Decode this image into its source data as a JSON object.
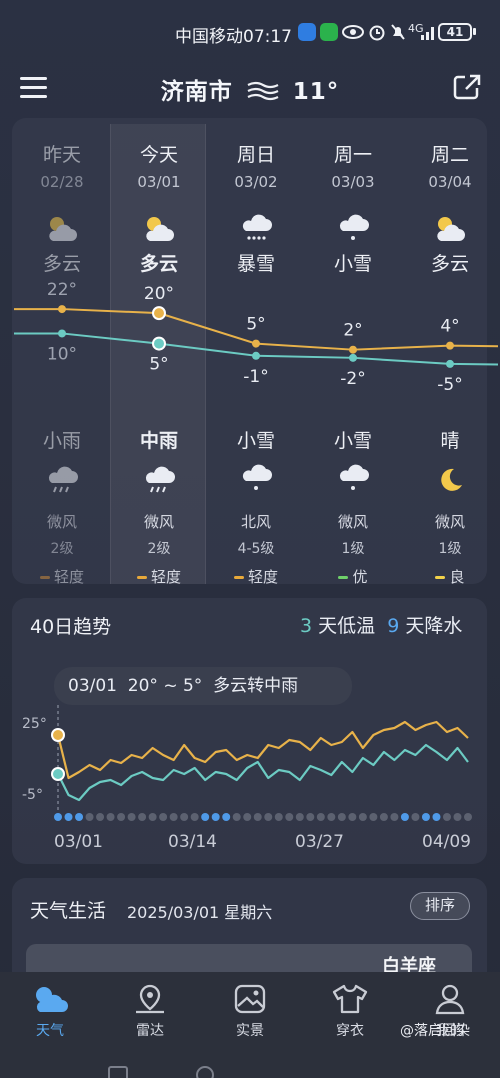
{
  "status_bar": {
    "carrier": "中国移动",
    "time": "07:17",
    "signal": "4G",
    "battery": "41"
  },
  "header": {
    "city": "济南市",
    "temp": "11°",
    "condition_icon": "haze-icon"
  },
  "days": [
    {
      "name": "昨天",
      "date": "02/28",
      "day_condition": "多云",
      "high": "22°",
      "low": "10°",
      "night_condition": "小雨",
      "wind_dir": "微风",
      "wind_level": "2级",
      "aqi": "轻度",
      "aqi_color": "#c98a3c",
      "day_icon": "partly-cloudy-icon",
      "night_icon": "rain-cloud-icon",
      "past": true
    },
    {
      "name": "今天",
      "date": "03/01",
      "day_condition": "多云",
      "high": "20°",
      "low": "5°",
      "night_condition": "中雨",
      "wind_dir": "微风",
      "wind_level": "2级",
      "aqi": "轻度",
      "aqi_color": "#e8a93a",
      "day_icon": "partly-cloudy-icon",
      "night_icon": "rain-cloud-icon",
      "today": true
    },
    {
      "name": "周日",
      "date": "03/02",
      "day_condition": "暴雪",
      "high": "5°",
      "low": "-1°",
      "night_condition": "小雪",
      "wind_dir": "北风",
      "wind_level": "4-5级",
      "aqi": "轻度",
      "aqi_color": "#e8a93a",
      "day_icon": "heavy-snow-icon",
      "night_icon": "snow-cloud-icon"
    },
    {
      "name": "周一",
      "date": "03/03",
      "day_condition": "小雪",
      "high": "2°",
      "low": "-2°",
      "night_condition": "小雪",
      "wind_dir": "微风",
      "wind_level": "1级",
      "aqi": "优",
      "aqi_color": "#6fd16a",
      "day_icon": "snow-cloud-icon",
      "night_icon": "snow-cloud-icon"
    },
    {
      "name": "周二",
      "date": "03/04",
      "day_condition": "多云",
      "high": "4°",
      "low": "-5°",
      "night_condition": "晴",
      "wind_dir": "微风",
      "wind_level": "1级",
      "aqi": "良",
      "aqi_color": "#f2d24a",
      "day_icon": "partly-cloudy-icon",
      "night_icon": "moon-icon"
    }
  ],
  "trend": {
    "title": "40日趋势",
    "low_days": "3",
    "low_label": "天低温",
    "rain_days": "9",
    "rain_label": "天降水",
    "tooltip": "03/01  20° ~ 5°  多云转中雨",
    "y_ticks": [
      "25°",
      "-5°"
    ],
    "x_ticks": [
      "03/01",
      "03/14",
      "03/27",
      "04/09"
    ],
    "high_color": "#e8b24a",
    "low_color": "#6ccbc3"
  },
  "life": {
    "title": "天气生活",
    "date": "2025/03/01 星期六",
    "sort_label": "排序",
    "card_text": "白羊座"
  },
  "tabs": [
    {
      "label": "天气",
      "icon": "weather-icon",
      "active": true
    },
    {
      "label": "雷达",
      "icon": "radar-pin-icon"
    },
    {
      "label": "实景",
      "icon": "photo-icon"
    },
    {
      "label": "穿衣",
      "icon": "shirt-icon"
    },
    {
      "label": "我的",
      "icon": "user-icon"
    }
  ],
  "watermark": "@落启回染"
}
